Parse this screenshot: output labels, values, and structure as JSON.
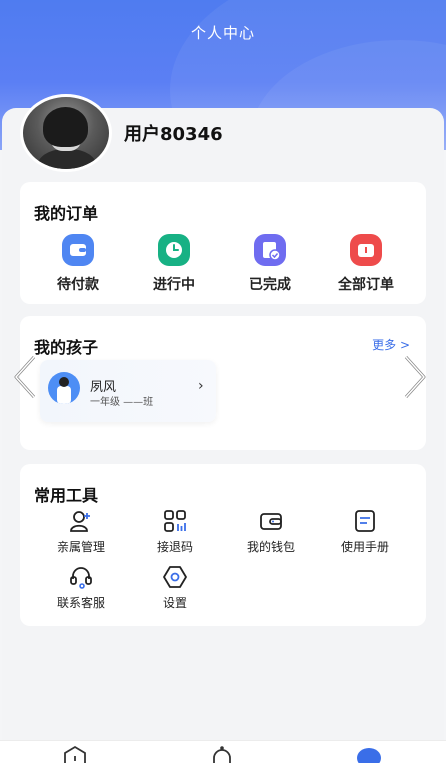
{
  "header": {
    "title": "个人中心"
  },
  "profile": {
    "username": "用户80346"
  },
  "orders": {
    "title": "我的订单",
    "items": [
      {
        "label": "待付款",
        "icon": "wallet-icon",
        "color": "#4f86f2"
      },
      {
        "label": "进行中",
        "icon": "clock-icon",
        "color": "#17b184"
      },
      {
        "label": "已完成",
        "icon": "completed-doc-icon",
        "color": "#6f6cf0"
      },
      {
        "label": "全部订单",
        "icon": "all-orders-icon",
        "color": "#ee4b4b"
      }
    ]
  },
  "kids": {
    "title": "我的孩子",
    "more": "更多 >",
    "child": {
      "name": "夙风",
      "class": "一年级 ——班"
    }
  },
  "tools": {
    "title": "常用工具",
    "items": [
      {
        "label": "亲属管理",
        "icon": "add-person-icon"
      },
      {
        "label": "接退码",
        "icon": "qr-grid-icon"
      },
      {
        "label": "我的钱包",
        "icon": "wallet-outline-icon"
      },
      {
        "label": "使用手册",
        "icon": "manual-icon"
      },
      {
        "label": "联系客服",
        "icon": "headset-icon"
      },
      {
        "label": "设置",
        "icon": "settings-hex-icon"
      }
    ]
  },
  "colors": {
    "accent": "#4f7cf0",
    "link": "#3a6ee8"
  }
}
